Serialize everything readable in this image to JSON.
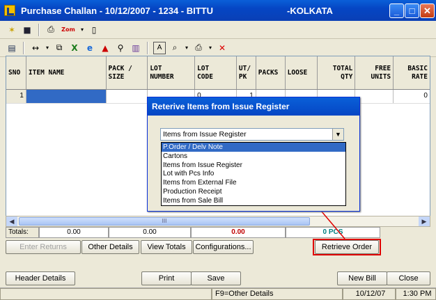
{
  "window": {
    "title": "Purchase Challan - 10/12/2007 - 1234 - BITTU",
    "city": "-KOLKATA",
    "min": "_",
    "max": "□",
    "close": "✕"
  },
  "grid": {
    "columns": [
      "SNO",
      "ITEM NAME",
      "PACK /\nSIZE",
      "LOT\nNUMBER",
      "LOT\nCODE",
      "UT/\nPK",
      "PACKS",
      "LOOSE",
      "TOTAL\nQTY",
      "FREE\nUNITS",
      "BASIC\nRATE"
    ],
    "row1": {
      "sno": "1",
      "lot_code": "0",
      "ut_pk": "1",
      "basic_rate": "0"
    }
  },
  "totals": {
    "label": "Totals:",
    "v1": "0.00",
    "v2": "0.00",
    "v3": "0.00",
    "pcs": "0 PCS"
  },
  "action_buttons": {
    "enter_returns": "Enter Returns",
    "other_details": "Other Details",
    "view_totals": "View Totals",
    "configurations": "Configurations...",
    "retrieve_order": "Retrieve Order"
  },
  "dialog": {
    "title": "Reterive Items from Issue Register",
    "selected": "Items from Issue Register",
    "options": [
      "P.Order / Delv Note",
      "Cartons",
      "Items from Issue Register",
      "Lot with Pcs Info",
      "Items from External File",
      "Production Receipt",
      "Items from Sale Bill"
    ]
  },
  "bottom_buttons": {
    "header_details": "Header Details",
    "print": "Print",
    "save": "Save",
    "new_bill": "New Bill",
    "close": "Close"
  },
  "status": {
    "hint": "F9=Other Details",
    "date": "10/12/07",
    "time": "1:30 PM"
  },
  "scroll": {
    "grip": "III"
  },
  "colors": {
    "highlight_box": "#e00000",
    "pcs_text": "#008080",
    "total_red": "#c00000"
  }
}
